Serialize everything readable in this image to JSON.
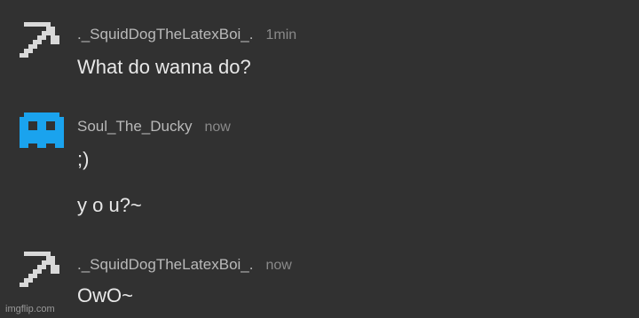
{
  "messages": [
    {
      "username": "._SquidDogTheLatexBoi_.",
      "timestamp": "1min",
      "avatar_icon": "pickaxe-icon",
      "avatar_color": "#d9d9d9",
      "lines": [
        "What do wanna do?"
      ]
    },
    {
      "username": "Soul_The_Ducky",
      "timestamp": "now",
      "avatar_icon": "ghost-icon",
      "avatar_color": "#1aa3ee",
      "lines": [
        ";)",
        "y o u?~"
      ]
    },
    {
      "username": "._SquidDogTheLatexBoi_.",
      "timestamp": "now",
      "avatar_icon": "pickaxe-icon",
      "avatar_color": "#d9d9d9",
      "lines": [
        "OwO~"
      ]
    }
  ],
  "watermark": "imgflip.com",
  "colors": {
    "background": "#313131",
    "username": "#b9b9b9",
    "timestamp": "#8a8a8a",
    "message_text": "#e8e8e8"
  }
}
